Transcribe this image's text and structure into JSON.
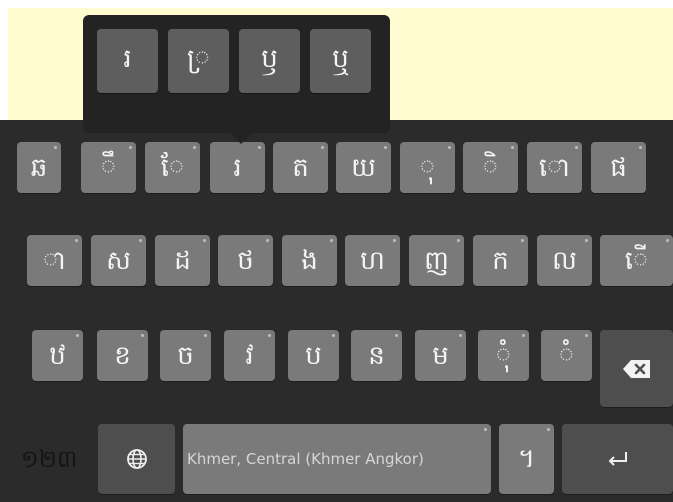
{
  "keyboard": {
    "row1": [
      "ឆ",
      "ឹ",
      "ែ",
      "រ",
      "ត",
      "យ",
      "ុ",
      "ិ",
      "ោ",
      "ផ"
    ],
    "row2": [
      "ា",
      "ស",
      "ដ",
      "ថ",
      "ង",
      "ហ",
      "ញ",
      "ក",
      "ល",
      "ើ"
    ],
    "row3": [
      "ឋ",
      "ខ",
      "ច",
      "វ",
      "ប",
      "ន",
      "ម",
      "ុំ",
      "ំ"
    ],
    "popup": [
      "រ",
      "្រ",
      "ឫ",
      "ឬ"
    ],
    "num_switch_label": "១២៣",
    "space_label": "Khmer, Central (Khmer Angkor)",
    "khmer_key": "។",
    "icons": {
      "globe": "globe-icon",
      "backspace": "backspace-icon",
      "enter": "enter-icon"
    }
  },
  "colors": {
    "app_background": "#fffcd2",
    "keyboard_background": "#2b2b2b",
    "key": "#7a7a7a",
    "dark_key": "#4e4e4e",
    "popup": "#232323"
  }
}
